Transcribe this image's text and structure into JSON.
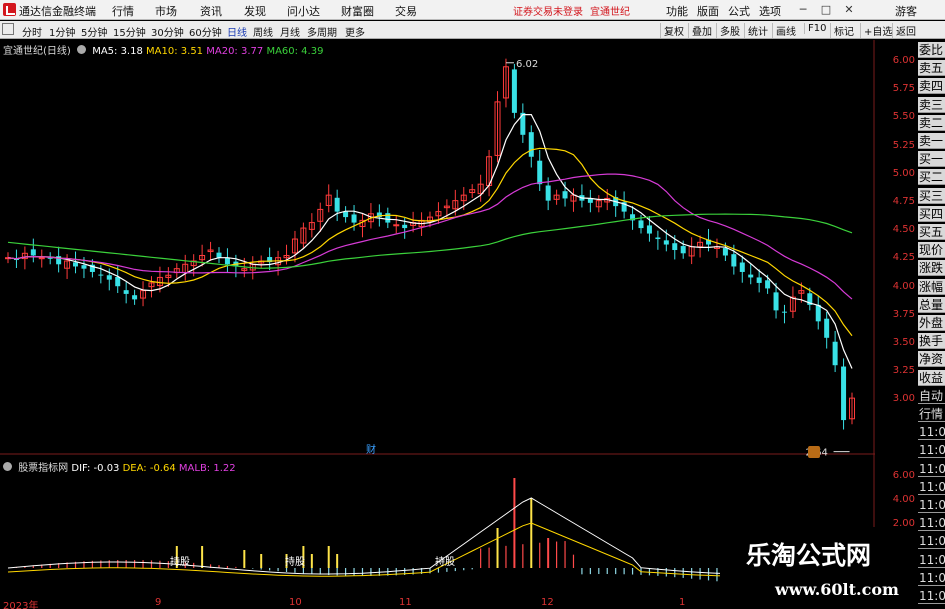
{
  "app": {
    "title": "通达信金融终端"
  },
  "menu": [
    "行情",
    "市场",
    "资讯",
    "发现",
    "问小达",
    "财富圈",
    "交易"
  ],
  "notice": {
    "text": "证券交易未登录",
    "stock": "宜通世纪"
  },
  "toolbar_right": [
    "功能",
    "版面",
    "公式",
    "选项"
  ],
  "guest": "游客",
  "periods": [
    "分时",
    "1分钟",
    "5分钟",
    "15分钟",
    "30分钟",
    "60分钟",
    "日线",
    "周线",
    "月线",
    "多周期",
    "更多"
  ],
  "active_period": "日线",
  "chart_tools": [
    "复权",
    "叠加",
    "多股",
    "统计",
    "画线",
    "F10",
    "标记",
    "+自选",
    "返回"
  ],
  "side_tabs": [
    "委比",
    "卖五",
    "卖四",
    "卖三",
    "卖二",
    "卖一",
    "买一",
    "买二",
    "买三",
    "买四",
    "买五",
    "现价",
    "涨跌",
    "涨幅",
    "总量",
    "外盘",
    "换手",
    "净资",
    "收益",
    "自动",
    "行情",
    "11:0",
    "11:0",
    "11:0",
    "11:0",
    "11:0",
    "11:0",
    "11:0",
    "11:0",
    "11:0",
    "11:0"
  ],
  "legend": {
    "name": "宜通世纪(日线)",
    "ma5": "MA5: 3.18",
    "ma10": "MA10: 3.51",
    "ma20": "MA20: 3.77",
    "ma60": "MA60: 4.39"
  },
  "indicator": {
    "name": "股票指标网",
    "dif": "DIF: -0.03",
    "dea": "DEA: -0.64",
    "malb": "MALB: 1.22"
  },
  "markers": {
    "high": "6.02",
    "low": "2.64",
    "event": "财"
  },
  "zone_labels": [
    "持股",
    "持股",
    "持股"
  ],
  "watermark": {
    "brand": "乐淘公式网",
    "url": "www.60lt.com"
  },
  "colors": {
    "up": "#ff3b3b",
    "down": "#39e1e6",
    "ma5": "#ffffff",
    "ma10": "#ffd700",
    "ma20": "#d63bd6",
    "ma60": "#3bd13b"
  },
  "chart_data": [
    {
      "type": "line",
      "title": "宜通世纪(日线)",
      "ylim": [
        2.5,
        6.15
      ],
      "yticks": [
        "6.00",
        "5.75",
        "5.50",
        "5.25",
        "5.00",
        "4.75",
        "4.50",
        "4.25",
        "4.00",
        "3.75",
        "3.50",
        "3.25",
        "3.00"
      ],
      "xticks": [
        "2023年",
        "9",
        "10",
        "11",
        "12",
        "1"
      ],
      "close": [
        4.28,
        4.26,
        4.32,
        4.3,
        4.28,
        4.27,
        4.22,
        4.25,
        4.2,
        4.18,
        4.15,
        4.12,
        4.08,
        4.02,
        3.95,
        3.9,
        3.98,
        4.05,
        4.1,
        4.12,
        4.18,
        4.22,
        4.25,
        4.3,
        4.35,
        4.28,
        4.22,
        4.2,
        4.18,
        4.22,
        4.25,
        4.24,
        4.28,
        4.3,
        4.45,
        4.55,
        4.6,
        4.72,
        4.85,
        4.7,
        4.65,
        4.6,
        4.62,
        4.68,
        4.65,
        4.6,
        4.58,
        4.55,
        4.6,
        4.62,
        4.65,
        4.7,
        4.75,
        4.8,
        4.85,
        4.9,
        4.95,
        5.2,
        5.7,
        6.02,
        5.6,
        5.4,
        5.2,
        4.95,
        4.8,
        4.85,
        4.82,
        4.85,
        4.8,
        4.78,
        4.8,
        4.82,
        4.75,
        4.7,
        4.62,
        4.55,
        4.5,
        4.45,
        4.4,
        4.35,
        4.32,
        4.38,
        4.42,
        4.4,
        4.38,
        4.3,
        4.2,
        4.15,
        4.1,
        4.05,
        4.0,
        3.8,
        3.78,
        3.92,
        3.98,
        3.85,
        3.7,
        3.55,
        3.3,
        2.8,
        3.0
      ]
    },
    {
      "type": "bar",
      "title": "股票指标网",
      "ylim": [
        -3,
        7
      ],
      "yticks": [
        "6.00",
        "4.00",
        "2.00"
      ],
      "series": [
        {
          "name": "DIF"
        },
        {
          "name": "DEA"
        },
        {
          "name": "MALB"
        }
      ]
    }
  ]
}
